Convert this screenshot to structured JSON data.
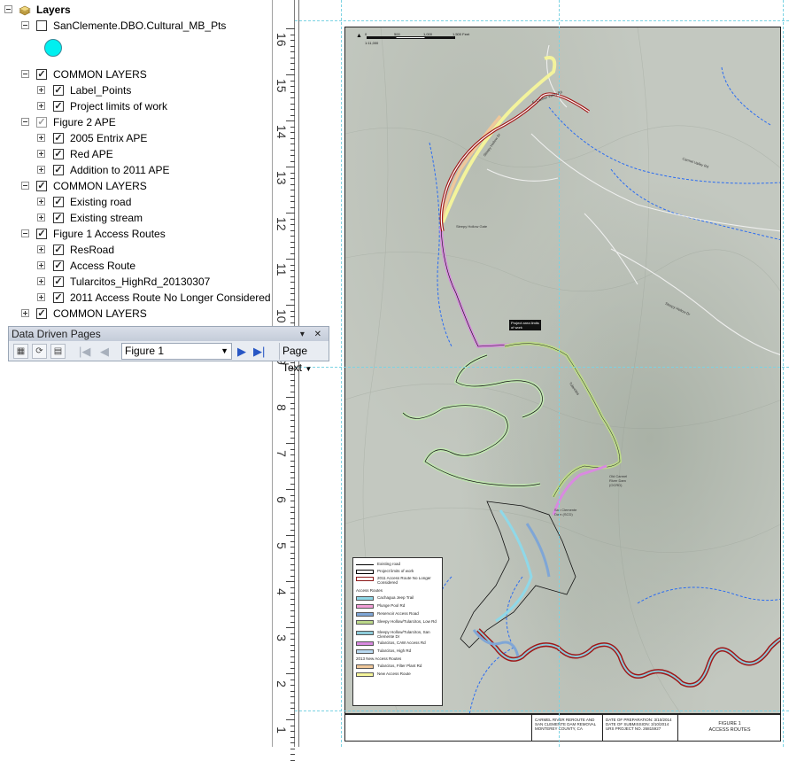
{
  "toc": {
    "root_label": "Layers",
    "items": [
      {
        "label": "SanClemente.DBO.Cultural_MB_Pts",
        "expanded": true,
        "checked": false
      },
      {
        "label": "COMMON LAYERS",
        "expanded": true,
        "checked": true
      },
      {
        "label": "Label_Points",
        "expanded": false,
        "checked": true
      },
      {
        "label": "Project limits of work",
        "expanded": false,
        "checked": true
      },
      {
        "label": "Figure 2 APE",
        "expanded": true,
        "checked": true
      },
      {
        "label": "2005 Entrix APE",
        "expanded": false,
        "checked": true
      },
      {
        "label": "Red APE",
        "expanded": false,
        "checked": true
      },
      {
        "label": "Addition to 2011 APE",
        "expanded": false,
        "checked": true
      },
      {
        "label": "COMMON LAYERS",
        "expanded": true,
        "checked": true
      },
      {
        "label": "Existing road",
        "expanded": false,
        "checked": true
      },
      {
        "label": "Existing stream",
        "expanded": false,
        "checked": true
      },
      {
        "label": "Figure 1 Access Routes",
        "expanded": true,
        "checked": true
      },
      {
        "label": "ResRoad",
        "expanded": false,
        "checked": true
      },
      {
        "label": "Access Route",
        "expanded": false,
        "checked": true
      },
      {
        "label": "Tularcitos_HighRd_20130307",
        "expanded": false,
        "checked": true
      },
      {
        "label": "2011 Access Route No Longer Considered",
        "expanded": false,
        "checked": true
      },
      {
        "label": "COMMON LAYERS",
        "expanded": false,
        "checked": true
      }
    ],
    "symbol_color": "#00f0f0"
  },
  "ddp_toolbar": {
    "title": "Data Driven Pages",
    "controls": "▾ ✕",
    "current_page": "Figure 1",
    "page_text_label": "Page Text"
  },
  "ruler": {
    "labels": [
      "16",
      "15",
      "14",
      "13",
      "12",
      "11",
      "10",
      "9",
      "8",
      "7",
      "6",
      "5",
      "4",
      "3",
      "2",
      "1"
    ]
  },
  "map": {
    "scale_text": "1:11,000",
    "scale_ticks": [
      "0",
      "500",
      "1,000",
      "1,500 Feet"
    ],
    "callouts": [
      "Project area limits of work",
      "Sleepy Hollow Gate",
      "Old Carmel River Dam (OCRD)",
      "San Clemente Dam (SCD)"
    ],
    "legend": {
      "entries": [
        {
          "label": "Existing road",
          "color": "#000000"
        },
        {
          "label": "Project limits of work",
          "color": "#000000"
        },
        {
          "label": "2011 Access Route No Longer Considered",
          "color": "#8b1a1a"
        }
      ],
      "access_heading": "Access Routes",
      "access_entries": [
        {
          "label": "Cachagua Jeep Trail",
          "color": "#8fd8e8"
        },
        {
          "label": "Plunge Pool Rd",
          "color": "#f29ed6"
        },
        {
          "label": "Reservoir Access Road",
          "color": "#7fa6d6"
        },
        {
          "label": "Sleepy Hollow/Tularcitos, Low Rd",
          "color": "#bcd98a"
        },
        {
          "label": "Sleepy Hollow/Tularcitos, San Clemente Dr",
          "color": "#8dcbd9"
        },
        {
          "label": "Tularcitos, CAW Access Rd",
          "color": "#d98ae0"
        },
        {
          "label": "Tularcitos, High Rd",
          "color": "#b9d9f0"
        }
      ],
      "new_heading": "2013 New Access Routes",
      "new_entries": [
        {
          "label": "Tularcitos, Filter Plant Rd",
          "color": "#f0c89a"
        },
        {
          "label": "New Access Route",
          "color": "#f5f59a"
        }
      ]
    },
    "road_labels": [
      "Carmel Valley Rd",
      "E. Carmel Valley Rd",
      "Sleepy Hollow Dr",
      "Tularcitos",
      "Sleepy Hollow Dr"
    ]
  },
  "title_block": {
    "project": "CARMEL RIVER REROUTE AND SAN CLEMENTE DAM REMOVAL MONTEREY COUNTY, CA",
    "dates": "DATE OF PREPARATION: 3/10/2014 DATE OF SUBMISSION: 3/10/2014 URS PROJECT NO. 26815927",
    "figure": "FIGURE 1",
    "figure_title": "ACCESS ROUTES"
  }
}
